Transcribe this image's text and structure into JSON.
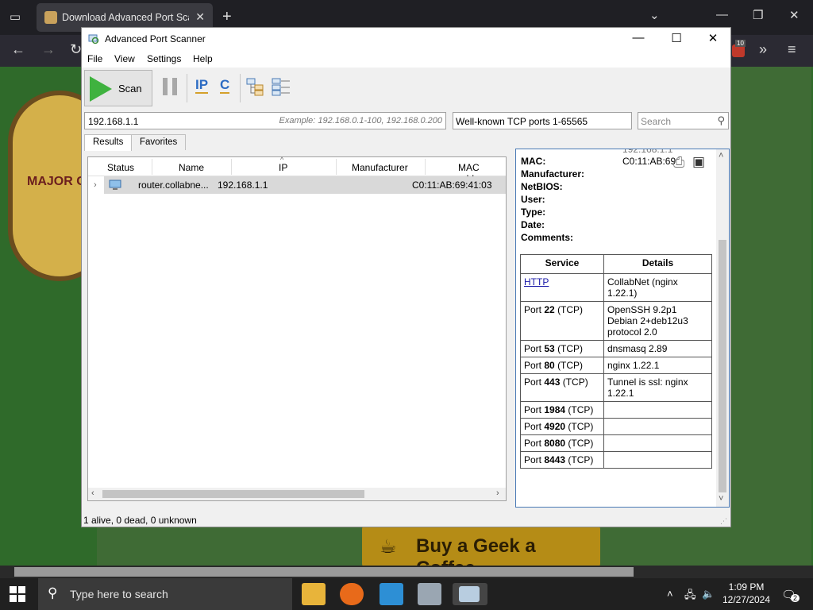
{
  "browser": {
    "tab_title": "Download Advanced Port Scan",
    "tab_close": "✕",
    "new_tab": "+",
    "badge": "10"
  },
  "website": {
    "logo_text": "MAJOR G",
    "coffee_button": "Buy a Geek a Coffee"
  },
  "app": {
    "title": "Advanced Port Scanner",
    "menu": [
      "File",
      "View",
      "Settings",
      "Help"
    ],
    "toolbar": {
      "scan_label": "Scan",
      "ip_label": "IP",
      "c_label": "C"
    },
    "address": {
      "value": "192.168.1.1",
      "hint": "Example: 192.168.0.1-100,  192.168.0.200"
    },
    "ports": {
      "value": "Well-known TCP ports 1-65565"
    },
    "search": {
      "placeholder": "Search"
    },
    "tabs": [
      "Results",
      "Favorites"
    ],
    "columns": [
      "Status",
      "Name",
      "IP",
      "Manufacturer",
      "MAC addre"
    ],
    "rows": [
      {
        "name": "router.collabne...",
        "ip": "192.168.1.1",
        "manufacturer": "",
        "mac": "C0:11:AB:69:41:03"
      }
    ],
    "details": {
      "ip_value": "192.168.1.1",
      "mac_label": "MAC:",
      "mac_value": "C0:11:AB:69",
      "labels": [
        "Manufacturer:",
        "NetBIOS:",
        "User:",
        "Type:",
        "Date:",
        "Comments:"
      ],
      "service_headers": [
        "Service",
        "Details"
      ],
      "services": [
        {
          "service_link": "HTTP",
          "details": "CollabNet (nginx 1.22.1)"
        },
        {
          "port_prefix": "Port",
          "port": "22",
          "proto": "(TCP)",
          "details": "OpenSSH 9.2p1 Debian 2+deb12u3 protocol 2.0"
        },
        {
          "port_prefix": "Port",
          "port": "53",
          "proto": "(TCP)",
          "details": "dnsmasq 2.89"
        },
        {
          "port_prefix": "Port",
          "port": "80",
          "proto": "(TCP)",
          "details": "nginx 1.22.1"
        },
        {
          "port_prefix": "Port",
          "port": "443",
          "proto": "(TCP)",
          "details": "Tunnel is ssl: nginx 1.22.1"
        },
        {
          "port_prefix": "Port",
          "port": "1984",
          "proto": "(TCP)",
          "details": ""
        },
        {
          "port_prefix": "Port",
          "port": "4920",
          "proto": "(TCP)",
          "details": ""
        },
        {
          "port_prefix": "Port",
          "port": "8080",
          "proto": "(TCP)",
          "details": ""
        },
        {
          "port_prefix": "Port",
          "port": "8443",
          "proto": "(TCP)",
          "details": ""
        }
      ]
    },
    "status_text": "1 alive, 0 dead, 0 unknown"
  },
  "taskbar": {
    "search_placeholder": "Type here to search",
    "time": "1:09 PM",
    "date": "12/27/2024",
    "notif_count": "2"
  },
  "colors": {
    "accent_link": "#1a1aa8",
    "scan_green": "#3fb23f",
    "detail_border": "#4a7ab5"
  }
}
